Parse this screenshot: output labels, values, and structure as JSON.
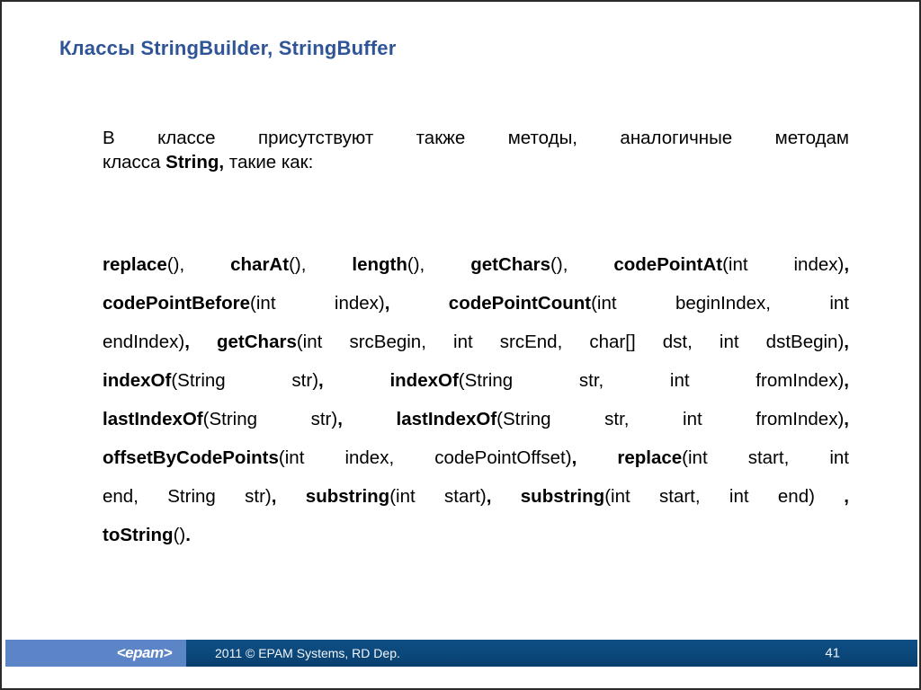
{
  "slide": {
    "title": "Классы StringBuilder, StringBuffer",
    "title_color": "#2f5597",
    "background_color": "#ffffff"
  },
  "intro": {
    "line1": "В классе присутствуют также методы, аналогичные методам",
    "line2_prefix": "класса ",
    "line2_bold": "String,",
    "line2_suffix": " такие как:"
  },
  "methods": {
    "line1": {
      "s1_bold": "replace",
      "s2": "(), ",
      "s3_bold": "charAt",
      "s4": "(), ",
      "s5_bold": "length",
      "s6": "(), ",
      "s7_bold": "getChars",
      "s8": "(), ",
      "s9_bold": "codePointAt",
      "s10": "(int index)",
      "s11_bold": ","
    },
    "line2": {
      "s1_bold": "codePointBefore",
      "s2": "(int index)",
      "s3_bold": ", ",
      "s4_bold2": "codePointCount",
      "s5": "(int beginIndex, int"
    },
    "line3": {
      "s1": "endIndex)",
      "s2_bold": ", ",
      "s3_bold2": "getChars",
      "s4": "(int srcBegin, int srcEnd, char[] dst, int dstBegin)",
      "s5_bold": ","
    },
    "line4": {
      "s1_bold": "indexOf",
      "s2": "(String str)",
      "s3_bold": ", ",
      "s4_bold2": "indexOf",
      "s5": "(String str, int fromIndex)",
      "s6_bold": ","
    },
    "line5": {
      "s1_bold": "lastIndexOf",
      "s2": "(String str)",
      "s3_bold": ", ",
      "s4_bold2": "lastIndexOf",
      "s5": "(String str, int fromIndex)",
      "s6_bold": ","
    },
    "line6": {
      "s1_bold": "offsetByCodePoints",
      "s2": "(int index, codePointOffset)",
      "s3_bold": ", ",
      "s4_bold2": "replace",
      "s5": "(int start, int"
    },
    "line7": {
      "s1": "end, String str)",
      "s2_bold": ", ",
      "s3_bold2": "substring",
      "s4": "(int start)",
      "s5_bold": ", ",
      "s6_bold2": "substring",
      "s7": "(int start, int end) ",
      "s8_bold": ","
    },
    "line8": {
      "s1_bold": "toString",
      "s2": "()",
      "s3_bold": "."
    }
  },
  "footer": {
    "logo_text": "<epam>",
    "logo_bg": "#5b85c6",
    "bar_bg": "#0b4b7f",
    "copyright": "2011 © EPAM Systems, RD Dep.",
    "page_number": "41"
  }
}
